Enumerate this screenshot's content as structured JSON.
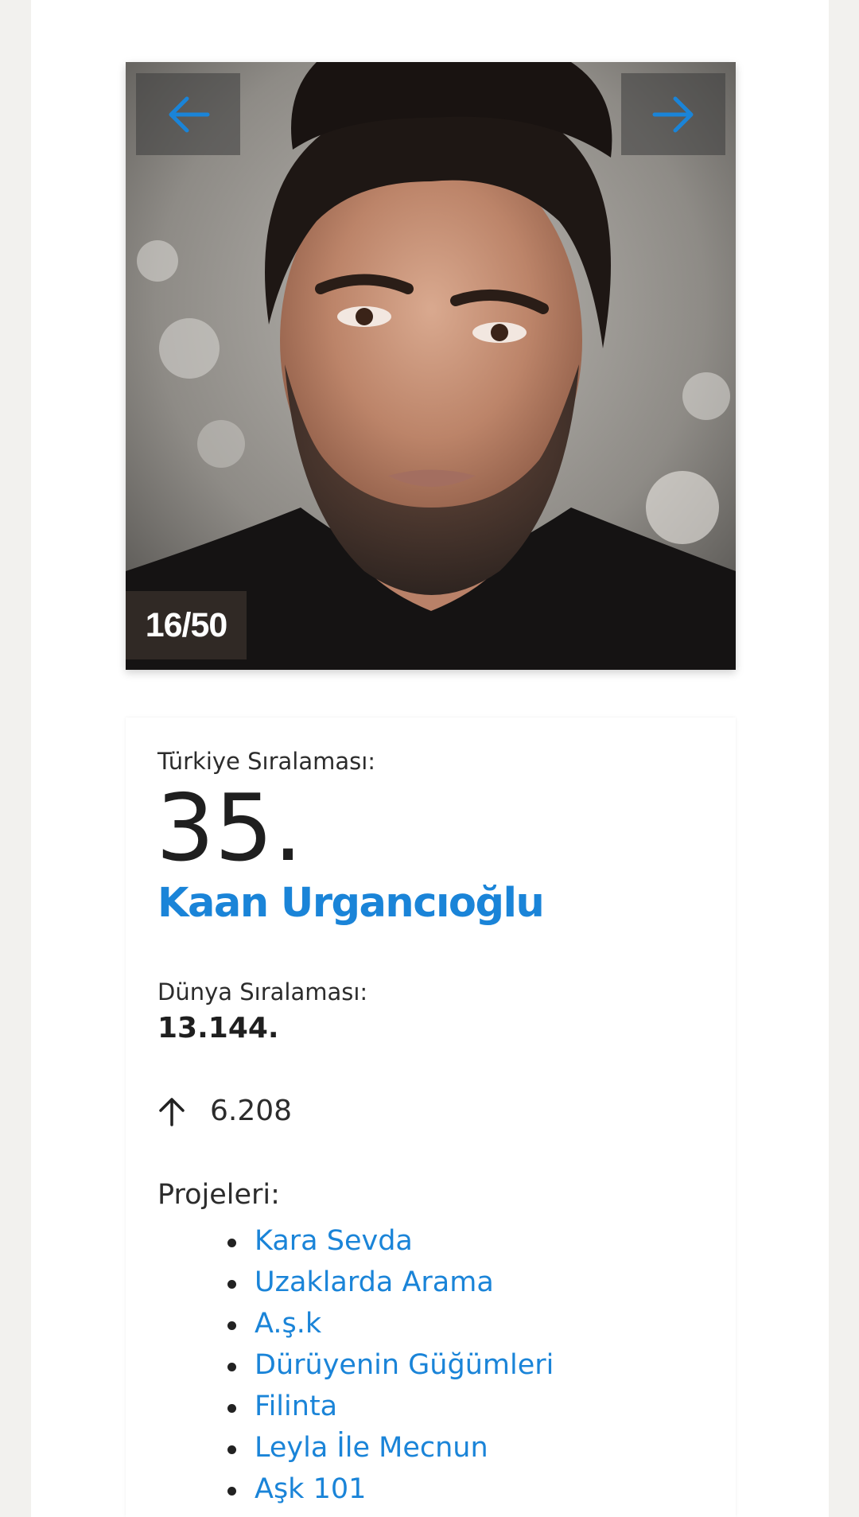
{
  "gallery": {
    "counter": "16/50",
    "photo_alt": "Kaan Urgancıoğlu",
    "prev_icon": "arrow-left-icon",
    "next_icon": "arrow-right-icon",
    "accent_color": "#1a84d8"
  },
  "profile": {
    "turkey_rank_label": "Türkiye Sıralaması:",
    "turkey_rank": "35.",
    "name": "Kaan Urgancıoğlu",
    "world_rank_label": "Dünya Sıralaması:",
    "world_rank": "13.144.",
    "change_icon": "arrow-up-icon",
    "change_value": "6.208",
    "projects_label": "Projeleri:",
    "projects": [
      "Kara Sevda",
      "Uzaklarda Arama",
      "A.ş.k",
      "Dürüyenin Güğümleri",
      "Filinta",
      "Leyla İle Mecnun",
      "Aşk 101"
    ]
  }
}
